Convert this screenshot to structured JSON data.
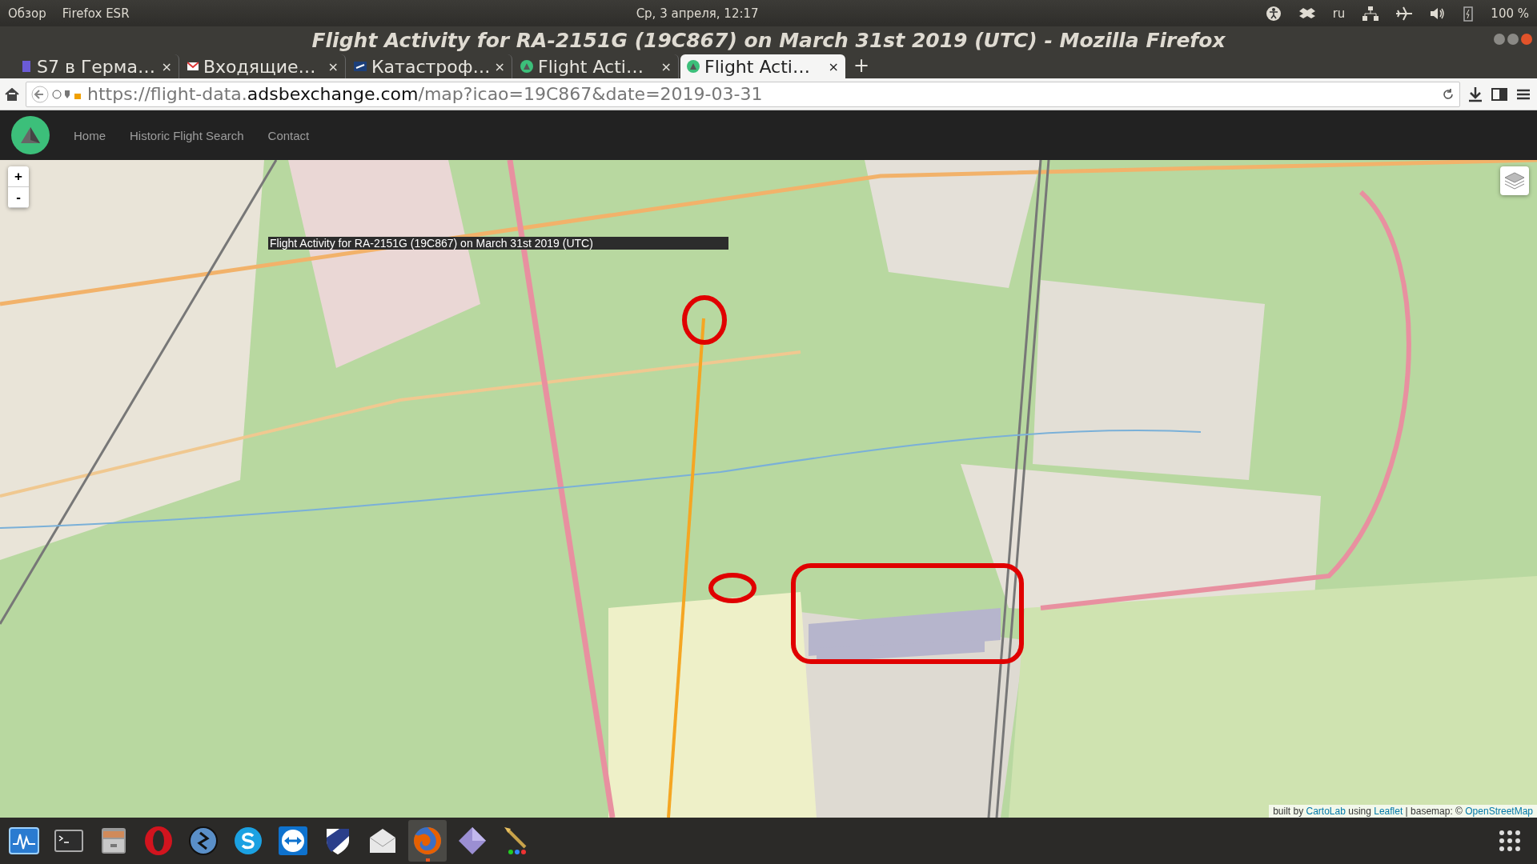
{
  "top_panel": {
    "activities": "Обзор",
    "app_menu": "Firefox ESR",
    "clock": "Ср, 3 апреля, 12:17",
    "language": "ru",
    "battery": "100 %"
  },
  "window": {
    "title": "Flight Activity for RA-2151G (19C867) on March 31st 2019 (UTC) - Mozilla Firefox"
  },
  "tabs": [
    {
      "label": "S7 в Герма…",
      "selected": false
    },
    {
      "label": "Входящие…",
      "selected": false
    },
    {
      "label": "Катастроф…",
      "selected": false
    },
    {
      "label": "Flight Acti…",
      "selected": false
    },
    {
      "label": "Flight Acti…",
      "selected": true
    }
  ],
  "tab_close": "×",
  "new_tab": "+",
  "url": {
    "prefix": "https://flight-data.",
    "domain": "adsbexchange.com",
    "path": "/map?icao=19C867&date=2019-03-31"
  },
  "nav": {
    "links": [
      "Home",
      "Historic Flight Search",
      "Contact"
    ]
  },
  "map": {
    "zoom_in": "+",
    "zoom_out": "-",
    "tooltip": "Flight Activity for RA-2151G (19C867) on March 31st 2019 (UTC)",
    "attribution": [
      {
        "text": "built by ",
        "kind": "text"
      },
      {
        "text": "CartoLab",
        "kind": "link"
      },
      {
        "text": " using ",
        "kind": "text"
      },
      {
        "text": "Leaflet",
        "kind": "link"
      },
      {
        "text": " | basemap: © ",
        "kind": "text"
      },
      {
        "text": "OpenStreetMap",
        "kind": "link"
      }
    ]
  },
  "taskbar": [
    {
      "kind": "monitor",
      "selected": false
    },
    {
      "kind": "terminal",
      "selected": false
    },
    {
      "kind": "files",
      "selected": false
    },
    {
      "kind": "opera",
      "selected": false
    },
    {
      "kind": "bolt",
      "selected": false
    },
    {
      "kind": "skype",
      "selected": false
    },
    {
      "kind": "arrows",
      "selected": false
    },
    {
      "kind": "shield",
      "selected": false
    },
    {
      "kind": "mail",
      "selected": false
    },
    {
      "kind": "firefox",
      "selected": true
    },
    {
      "kind": "diamond",
      "selected": false
    },
    {
      "kind": "brush",
      "selected": false
    }
  ]
}
